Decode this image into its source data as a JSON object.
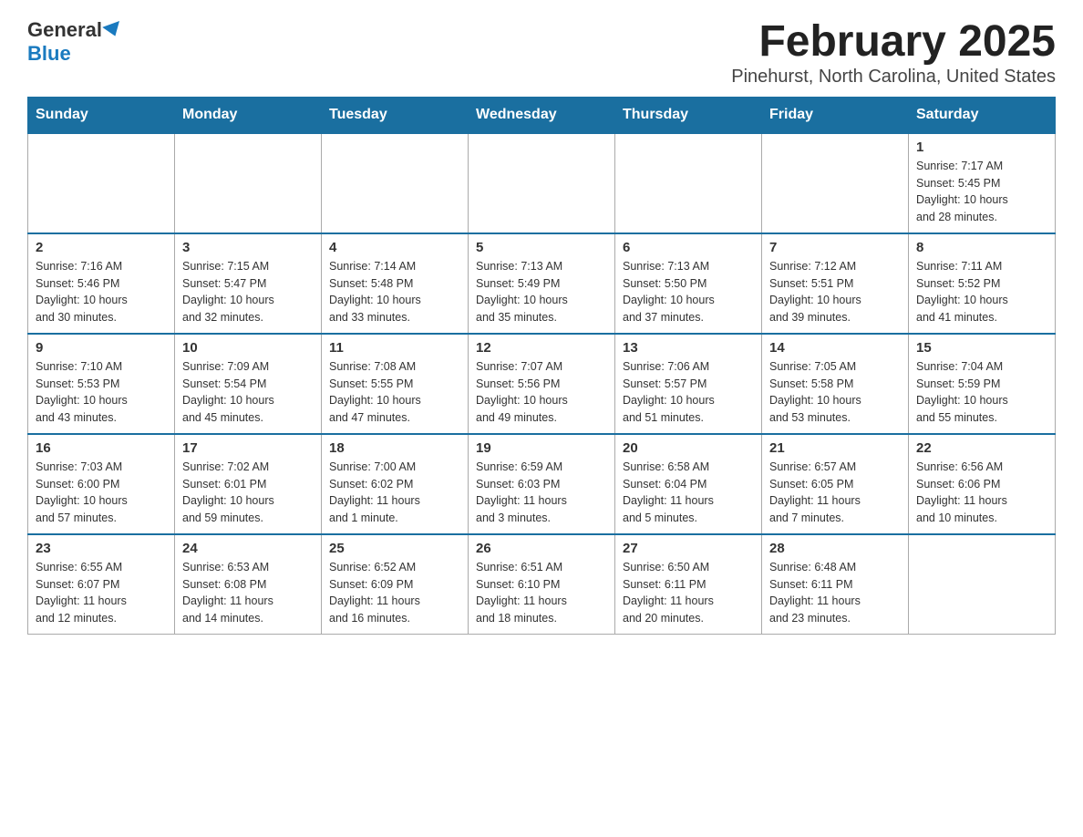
{
  "logo": {
    "general": "General",
    "blue": "Blue"
  },
  "title": "February 2025",
  "subtitle": "Pinehurst, North Carolina, United States",
  "weekdays": [
    "Sunday",
    "Monday",
    "Tuesday",
    "Wednesday",
    "Thursday",
    "Friday",
    "Saturday"
  ],
  "weeks": [
    [
      {
        "day": "",
        "info": ""
      },
      {
        "day": "",
        "info": ""
      },
      {
        "day": "",
        "info": ""
      },
      {
        "day": "",
        "info": ""
      },
      {
        "day": "",
        "info": ""
      },
      {
        "day": "",
        "info": ""
      },
      {
        "day": "1",
        "info": "Sunrise: 7:17 AM\nSunset: 5:45 PM\nDaylight: 10 hours\nand 28 minutes."
      }
    ],
    [
      {
        "day": "2",
        "info": "Sunrise: 7:16 AM\nSunset: 5:46 PM\nDaylight: 10 hours\nand 30 minutes."
      },
      {
        "day": "3",
        "info": "Sunrise: 7:15 AM\nSunset: 5:47 PM\nDaylight: 10 hours\nand 32 minutes."
      },
      {
        "day": "4",
        "info": "Sunrise: 7:14 AM\nSunset: 5:48 PM\nDaylight: 10 hours\nand 33 minutes."
      },
      {
        "day": "5",
        "info": "Sunrise: 7:13 AM\nSunset: 5:49 PM\nDaylight: 10 hours\nand 35 minutes."
      },
      {
        "day": "6",
        "info": "Sunrise: 7:13 AM\nSunset: 5:50 PM\nDaylight: 10 hours\nand 37 minutes."
      },
      {
        "day": "7",
        "info": "Sunrise: 7:12 AM\nSunset: 5:51 PM\nDaylight: 10 hours\nand 39 minutes."
      },
      {
        "day": "8",
        "info": "Sunrise: 7:11 AM\nSunset: 5:52 PM\nDaylight: 10 hours\nand 41 minutes."
      }
    ],
    [
      {
        "day": "9",
        "info": "Sunrise: 7:10 AM\nSunset: 5:53 PM\nDaylight: 10 hours\nand 43 minutes."
      },
      {
        "day": "10",
        "info": "Sunrise: 7:09 AM\nSunset: 5:54 PM\nDaylight: 10 hours\nand 45 minutes."
      },
      {
        "day": "11",
        "info": "Sunrise: 7:08 AM\nSunset: 5:55 PM\nDaylight: 10 hours\nand 47 minutes."
      },
      {
        "day": "12",
        "info": "Sunrise: 7:07 AM\nSunset: 5:56 PM\nDaylight: 10 hours\nand 49 minutes."
      },
      {
        "day": "13",
        "info": "Sunrise: 7:06 AM\nSunset: 5:57 PM\nDaylight: 10 hours\nand 51 minutes."
      },
      {
        "day": "14",
        "info": "Sunrise: 7:05 AM\nSunset: 5:58 PM\nDaylight: 10 hours\nand 53 minutes."
      },
      {
        "day": "15",
        "info": "Sunrise: 7:04 AM\nSunset: 5:59 PM\nDaylight: 10 hours\nand 55 minutes."
      }
    ],
    [
      {
        "day": "16",
        "info": "Sunrise: 7:03 AM\nSunset: 6:00 PM\nDaylight: 10 hours\nand 57 minutes."
      },
      {
        "day": "17",
        "info": "Sunrise: 7:02 AM\nSunset: 6:01 PM\nDaylight: 10 hours\nand 59 minutes."
      },
      {
        "day": "18",
        "info": "Sunrise: 7:00 AM\nSunset: 6:02 PM\nDaylight: 11 hours\nand 1 minute."
      },
      {
        "day": "19",
        "info": "Sunrise: 6:59 AM\nSunset: 6:03 PM\nDaylight: 11 hours\nand 3 minutes."
      },
      {
        "day": "20",
        "info": "Sunrise: 6:58 AM\nSunset: 6:04 PM\nDaylight: 11 hours\nand 5 minutes."
      },
      {
        "day": "21",
        "info": "Sunrise: 6:57 AM\nSunset: 6:05 PM\nDaylight: 11 hours\nand 7 minutes."
      },
      {
        "day": "22",
        "info": "Sunrise: 6:56 AM\nSunset: 6:06 PM\nDaylight: 11 hours\nand 10 minutes."
      }
    ],
    [
      {
        "day": "23",
        "info": "Sunrise: 6:55 AM\nSunset: 6:07 PM\nDaylight: 11 hours\nand 12 minutes."
      },
      {
        "day": "24",
        "info": "Sunrise: 6:53 AM\nSunset: 6:08 PM\nDaylight: 11 hours\nand 14 minutes."
      },
      {
        "day": "25",
        "info": "Sunrise: 6:52 AM\nSunset: 6:09 PM\nDaylight: 11 hours\nand 16 minutes."
      },
      {
        "day": "26",
        "info": "Sunrise: 6:51 AM\nSunset: 6:10 PM\nDaylight: 11 hours\nand 18 minutes."
      },
      {
        "day": "27",
        "info": "Sunrise: 6:50 AM\nSunset: 6:11 PM\nDaylight: 11 hours\nand 20 minutes."
      },
      {
        "day": "28",
        "info": "Sunrise: 6:48 AM\nSunset: 6:11 PM\nDaylight: 11 hours\nand 23 minutes."
      },
      {
        "day": "",
        "info": ""
      }
    ]
  ]
}
